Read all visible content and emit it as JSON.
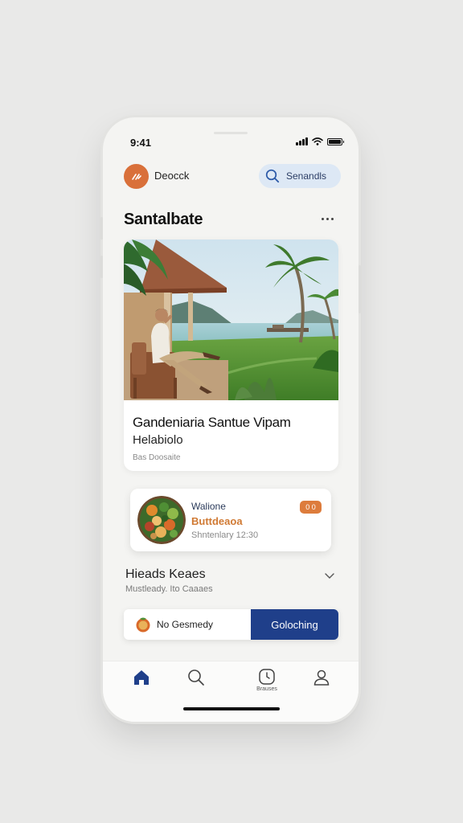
{
  "status_bar": {
    "time": "9:41"
  },
  "header": {
    "brand_name": "Deocck",
    "search_label": "Senandls"
  },
  "section": {
    "title": "Santalbate"
  },
  "hero_card": {
    "title": "Gandeniaria Santue Vipam",
    "subtitle": "Helabiolo",
    "meta": "Bas Doosaite"
  },
  "food_card": {
    "label": "Walione",
    "name": "Buttdeaoa",
    "time": "Shntenlary 12:30",
    "badge": "0 0"
  },
  "fold_section": {
    "title": "Hieads Keaes",
    "subtitle": "Mustleady. Ito Caaaes"
  },
  "action_bar": {
    "left_label": "No Gesmedy",
    "button_label": "Goloching"
  },
  "tabbar": {
    "items": [
      {
        "icon": "home-icon",
        "label": ""
      },
      {
        "icon": "search-icon",
        "label": ""
      },
      {
        "icon": "clock-icon",
        "label": "Brauses"
      },
      {
        "icon": "profile-icon",
        "label": ""
      }
    ]
  },
  "colors": {
    "accent_orange": "#d9703a",
    "primary_blue": "#1f3f8a",
    "search_pill_bg": "#dde8f5"
  }
}
